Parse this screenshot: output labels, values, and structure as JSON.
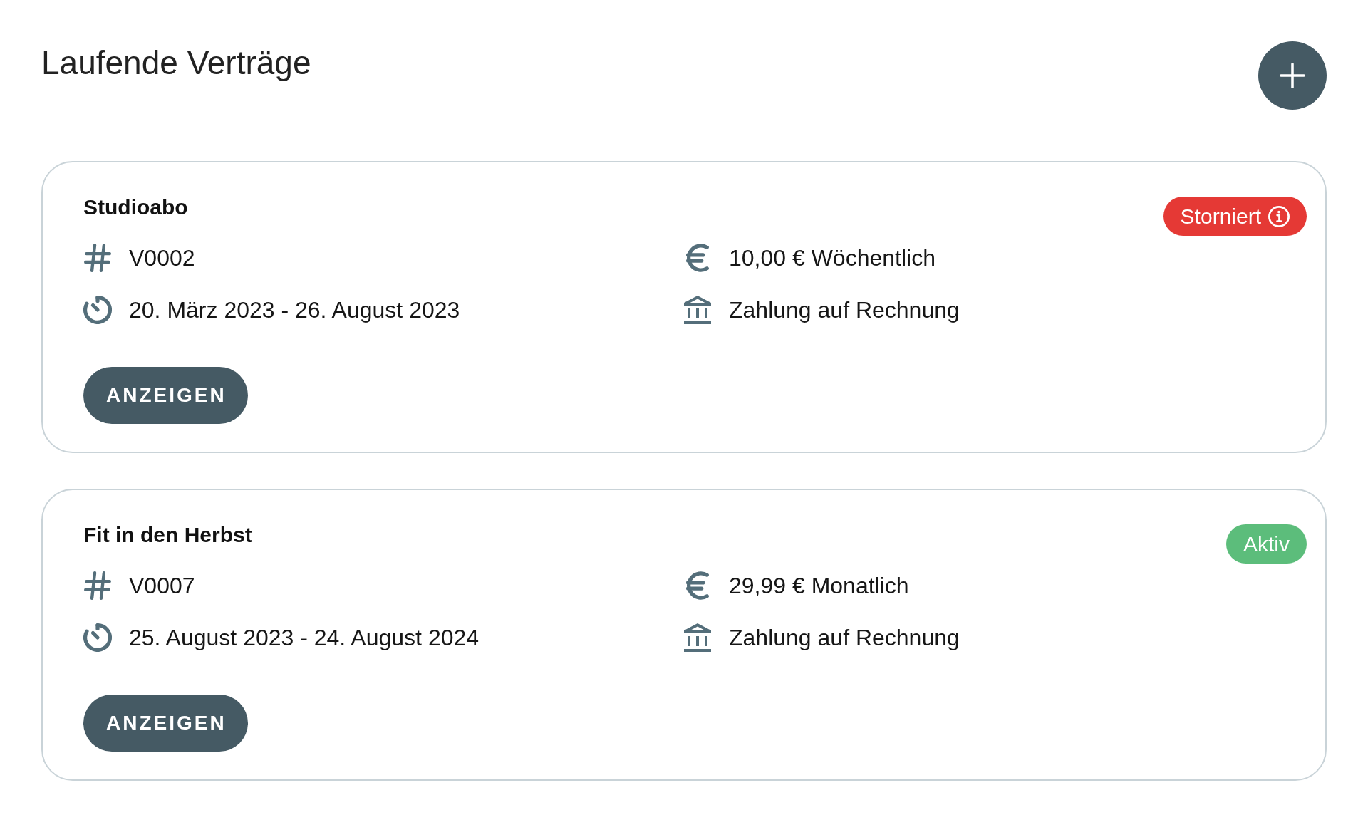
{
  "page_title": "Laufende Verträge",
  "contracts": [
    {
      "title": "Studioabo",
      "status": {
        "label": "Storniert",
        "color": "#e53935",
        "info": true
      },
      "number": "V0002",
      "period": "20. März 2023 - 26. August 2023",
      "price": "10,00 € Wöchentlich",
      "payment": "Zahlung auf Rechnung",
      "button": "ANZEIGEN"
    },
    {
      "title": "Fit in den Herbst",
      "status": {
        "label": "Aktiv",
        "color": "#5cbd7b",
        "info": false
      },
      "number": "V0007",
      "period": "25. August 2023 - 24. August 2024",
      "price": "29,99 € Monatlich",
      "payment": "Zahlung auf Rechnung",
      "button": "ANZEIGEN"
    }
  ]
}
